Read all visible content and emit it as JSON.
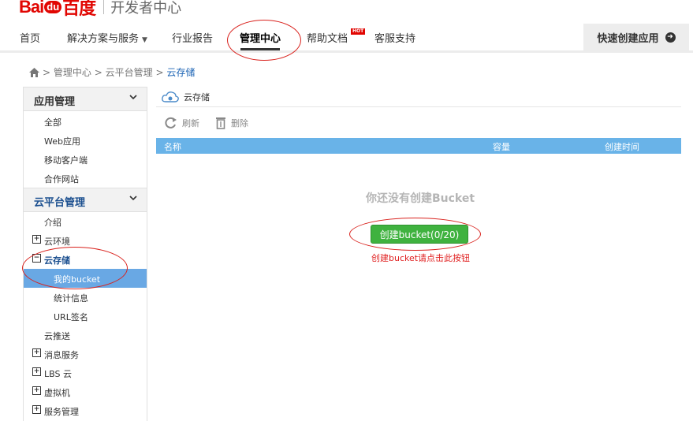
{
  "logo": {
    "part1": "Bai",
    "part2": "du",
    "part3": "百度",
    "subtitle": "开发者中心"
  },
  "nav": {
    "items": [
      "首页",
      "解决方案与服务",
      "行业报告",
      "管理中心",
      "帮助文档",
      "客服支持"
    ],
    "hot_badge": "HOT",
    "quick_create": "快速创建应用"
  },
  "breadcrumb": {
    "items": [
      "管理中心",
      "云平台管理"
    ],
    "current": "云存储",
    "separator": ">"
  },
  "sidebar": {
    "app_mgmt": "应用管理",
    "app_items": [
      "全部",
      "Web应用",
      "移动客户端",
      "合作网站"
    ],
    "cloud_mgmt": "云平台管理",
    "intro": "介绍",
    "cloud_env": "云环境",
    "cloud_storage": "云存储",
    "my_bucket": "我的bucket",
    "stats": "统计信息",
    "url_sign": "URL签名",
    "cloud_push": "云推送",
    "msg_service": "消息服务",
    "lbs": "LBS 云",
    "vm": "虚拟机",
    "service_mgmt": "服务管理"
  },
  "main": {
    "title": "云存储",
    "refresh": "刷新",
    "delete": "删除",
    "columns": [
      "名称",
      "容量",
      "创建时间"
    ],
    "empty_message": "你还没有创建Bucket",
    "create_button": "创建bucket(0/20)",
    "hint": "创建bucket请点击此按钮"
  },
  "colors": {
    "brand_red": "#e10602",
    "selected_blue": "#69a8e4",
    "table_head": "#69b3e8",
    "button_green": "#3fb23f",
    "annotation_red": "#d9221d"
  }
}
